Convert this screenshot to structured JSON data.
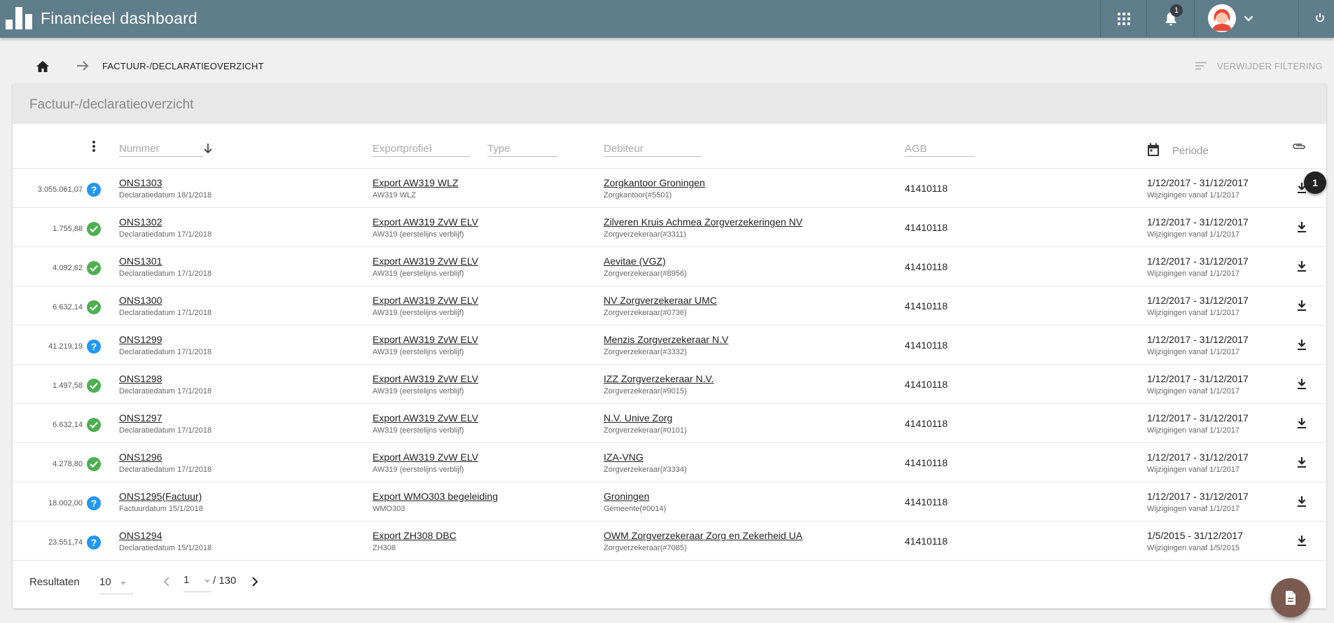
{
  "app": {
    "title": "Financieel dashboard",
    "notification_count": "1"
  },
  "breadcrumb": {
    "current": "FACTUUR-/DECLARATIEOVERZICHT"
  },
  "actions": {
    "clear_filter": "VERWIJDER FILTERING"
  },
  "card": {
    "title": "Factuur-/declaratieoverzicht"
  },
  "filters": {
    "nummer": "Nummer",
    "exportprofiel": "Exportprofiel",
    "type": "Type",
    "debiteur": "Debiteur",
    "agb": "AGB",
    "periode": "Periode"
  },
  "rows": [
    {
      "amount": "3.055.061,07",
      "status": "question",
      "number": "ONS1303",
      "number_sub": "Declaratiedatum 18/1/2018",
      "export": "Export AW319 WLZ",
      "export_sub": "AW319 WLZ",
      "debtor": "Zorgkantoor Groningen",
      "debtor_sub": "Zorgkantoor(#5501)",
      "agb": "41410118",
      "period": "1/12/2017 - 31/12/2017",
      "changes": "Wijzigingen vanaf 1/1/2017"
    },
    {
      "amount": "1.755,88",
      "status": "ok",
      "number": "ONS1302",
      "number_sub": "Declaratiedatum 17/1/2018",
      "export": "Export AW319 ZvW ELV",
      "export_sub": "AW319 (eerstelijns verblijf)",
      "debtor": "Zilveren Kruis Achmea Zorgverzekeringen NV",
      "debtor_sub": "Zorgverzekeraar(#3311)",
      "agb": "41410118",
      "period": "1/12/2017 - 31/12/2017",
      "changes": "Wijzigingen vanaf 1/1/2017"
    },
    {
      "amount": "4.092,62",
      "status": "ok",
      "number": "ONS1301",
      "number_sub": "Declaratiedatum 17/1/2018",
      "export": "Export AW319 ZvW ELV",
      "export_sub": "AW319 (eerstelijns verblijf)",
      "debtor": "Aevitae (VGZ)",
      "debtor_sub": "Zorgverzekeraar(#8956)",
      "agb": "41410118",
      "period": "1/12/2017 - 31/12/2017",
      "changes": "Wijzigingen vanaf 1/1/2017"
    },
    {
      "amount": "6.632,14",
      "status": "ok",
      "number": "ONS1300",
      "number_sub": "Declaratiedatum 17/1/2018",
      "export": "Export AW319 ZvW ELV",
      "export_sub": "AW319 (eerstelijns verblijf)",
      "debtor": "NV Zorgverzekeraar UMC",
      "debtor_sub": "Zorgverzekeraar(#0736)",
      "agb": "41410118",
      "period": "1/12/2017 - 31/12/2017",
      "changes": "Wijzigingen vanaf 1/1/2017"
    },
    {
      "amount": "41.219,19",
      "status": "question",
      "number": "ONS1299",
      "number_sub": "Declaratiedatum 17/1/2018",
      "export": "Export AW319 ZvW ELV",
      "export_sub": "AW319 (eerstelijns verblijf)",
      "debtor": "Menzis Zorgverzekeraar N.V",
      "debtor_sub": "Zorgverzekeraar(#3332)",
      "agb": "41410118",
      "period": "1/12/2017 - 31/12/2017",
      "changes": "Wijzigingen vanaf 1/1/2017"
    },
    {
      "amount": "1.497,58",
      "status": "ok",
      "number": "ONS1298",
      "number_sub": "Declaratiedatum 17/1/2018",
      "export": "Export AW319 ZvW ELV",
      "export_sub": "AW319 (eerstelijns verblijf)",
      "debtor": "IZZ Zorgverzekeraar N.V.",
      "debtor_sub": "Zorgverzekeraar(#9015)",
      "agb": "41410118",
      "period": "1/12/2017 - 31/12/2017",
      "changes": "Wijzigingen vanaf 1/1/2017"
    },
    {
      "amount": "6.632,14",
      "status": "ok",
      "number": "ONS1297",
      "number_sub": "Declaratiedatum 17/1/2018",
      "export": "Export AW319 ZvW ELV",
      "export_sub": "AW319 (eerstelijns verblijf)",
      "debtor": "N.V. Unive Zorg",
      "debtor_sub": "Zorgverzekeraar(#0101)",
      "agb": "41410118",
      "period": "1/12/2017 - 31/12/2017",
      "changes": "Wijzigingen vanaf 1/1/2017"
    },
    {
      "amount": "4.278,80",
      "status": "ok",
      "number": "ONS1296",
      "number_sub": "Declaratiedatum 17/1/2018",
      "export": "Export AW319 ZvW ELV",
      "export_sub": "AW319 (eerstelijns verblijf)",
      "debtor": "IZA-VNG",
      "debtor_sub": "Zorgverzekeraar(#3334)",
      "agb": "41410118",
      "period": "1/12/2017 - 31/12/2017",
      "changes": "Wijzigingen vanaf 1/1/2017"
    },
    {
      "amount": "18.002,00",
      "status": "question",
      "number": "ONS1295(Factuur)",
      "number_sub": "Factuurdatum 15/1/2018",
      "export": "Export WMO303 begeleiding",
      "export_sub": "WMO303",
      "debtor": "Groningen",
      "debtor_sub": "Gemeente(#0014)",
      "agb": "41410118",
      "period": "1/12/2017 - 31/12/2017",
      "changes": "Wijzigingen vanaf 1/1/2017"
    },
    {
      "amount": "23.551,74",
      "status": "question",
      "number": "ONS1294",
      "number_sub": "Declaratiedatum 15/1/2018",
      "export": "Export ZH308 DBC",
      "export_sub": "ZH308",
      "debtor": "OWM Zorgverzekeraar Zorg en Zekerheid UA",
      "debtor_sub": "Zorgverzekeraar(#7085)",
      "agb": "41410118",
      "period": "1/5/2015 - 31/12/2017",
      "changes": "Wijzigingen vanaf 1/5/2015"
    }
  ],
  "annotation": "1",
  "pagination": {
    "results_label": "Resultaten",
    "per_page": "10",
    "page": "1",
    "total": "/ 130"
  },
  "colors": {
    "topbar": "#5f7d8b",
    "ok": "#4caf50",
    "question": "#2196f3",
    "fab": "#7b5a4f"
  }
}
